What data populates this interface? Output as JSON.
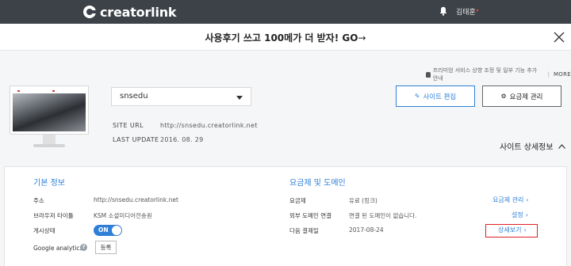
{
  "topbar": {
    "brand": "creatorlink",
    "user_name": "김태훈"
  },
  "promo": {
    "text": "사용후기 쓰고 100메가 더 받자! GO",
    "arrow": "→"
  },
  "notice": {
    "text": "프리미엄 서비스 상향 조정 및 일부 기능 추가 안내",
    "more": "MORE"
  },
  "site": {
    "selected": "snsedu",
    "url_label": "SITE URL",
    "url_value": "http://snsedu.creatorlink.net",
    "update_label": "LAST UPDATE",
    "update_value": "2016. 08. 29",
    "edit_button": "사이트 편집",
    "plan_button": "요금제 관리",
    "detail_toggle": "사이트 상세정보"
  },
  "basic": {
    "title": "기본 정보",
    "address_label": "주소",
    "address_value": "http://snsedu.creatorlink.net",
    "browser_title_label": "브라우저 타이틀",
    "browser_title_value": "KSM 소셜미디어전송원",
    "publish_label": "게시상태",
    "publish_toggle": "ON",
    "analytics_label": "Google analytics",
    "register_button": "등록"
  },
  "plan": {
    "title": "요금제 및 도메인",
    "plan_label": "요금제",
    "plan_value": "유료 (링크)",
    "plan_link": "요금제 관리",
    "domain_label": "외부 도메인 연결",
    "domain_value": "연결 된 도메인이 없습니다.",
    "domain_link": "설정",
    "payment_label": "다음 결제일",
    "payment_value": "2017-08-24",
    "detail_link": "상세보기",
    "link_arrow": "›"
  },
  "colors": {
    "topbar": "#3d4248",
    "accent": "#2f7fd8",
    "highlight": "#e02020"
  }
}
